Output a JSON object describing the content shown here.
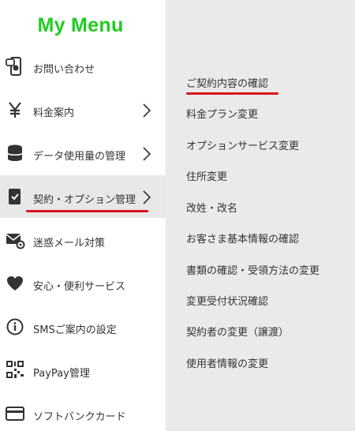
{
  "menu": {
    "title": "My Menu",
    "items": [
      {
        "label": "お問い合わせ",
        "icon": "smartphone-chat-icon"
      },
      {
        "label": "料金案内",
        "icon": "yen-icon"
      },
      {
        "label": "データ使用量の管理",
        "icon": "database-icon"
      },
      {
        "label": "契約・オプション管理",
        "icon": "clipboard-check-icon"
      },
      {
        "label": "迷惑メール対策",
        "icon": "mail-gear-icon"
      },
      {
        "label": "安心・便利サービス",
        "icon": "heart-icon"
      },
      {
        "label": "SMSご案内の設定",
        "icon": "info-circle-icon"
      },
      {
        "label": "PayPay管理",
        "icon": "qr-code-icon"
      },
      {
        "label": "ソフトバンクカード",
        "icon": "credit-card-icon"
      }
    ]
  },
  "submenu": {
    "items": [
      "ご契約内容の確認",
      "料金プラン変更",
      "オプションサービス変更",
      "住所変更",
      "改姓・改名",
      "お客さま基本情報の確認",
      "書類の確認・受領方法の変更",
      "変更受付状況確認",
      "契約者の変更（譲渡）",
      "使用者情報の変更"
    ]
  },
  "colors": {
    "accent_green": "#1fcc1f",
    "highlight_red": "#d7141d",
    "panel_gray": "#eaeaea"
  }
}
